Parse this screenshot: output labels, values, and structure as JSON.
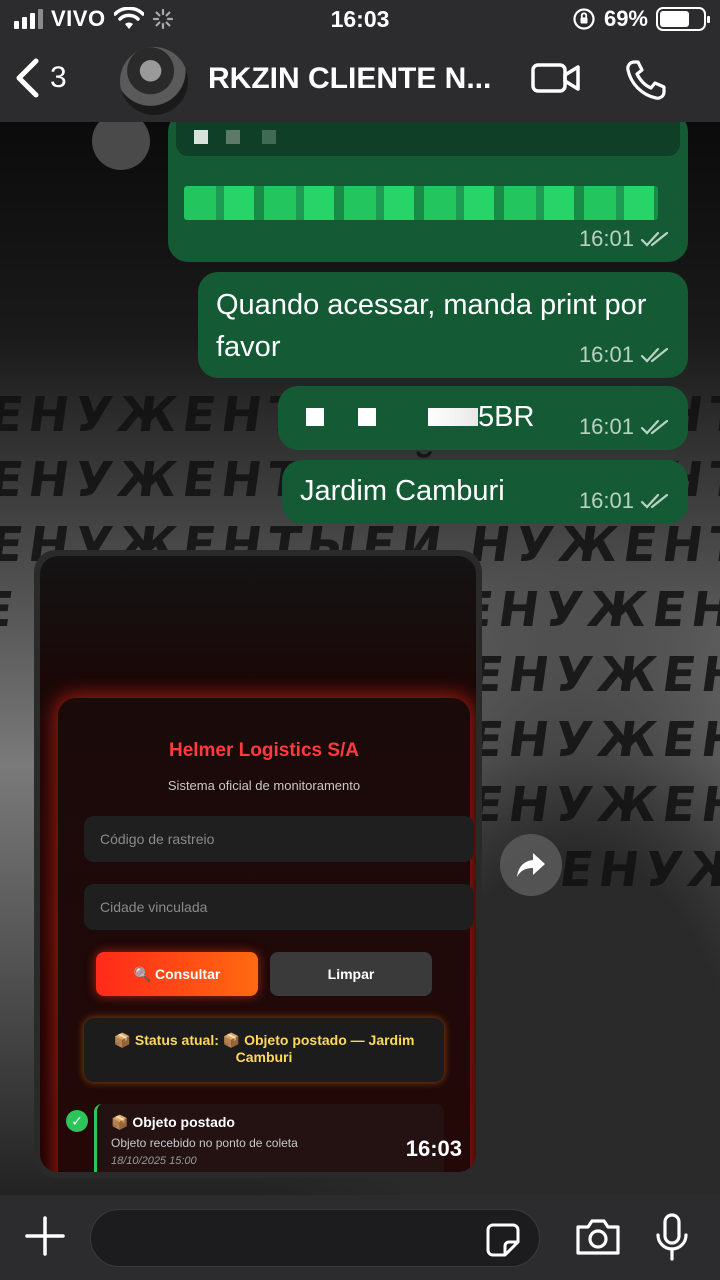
{
  "status_bar": {
    "carrier": "VIVO",
    "time": "16:03",
    "battery_percent": "69%",
    "battery_level": 0.69
  },
  "header": {
    "back_count": "3",
    "contact_name": "RKZIN CLIENTE N..."
  },
  "messages": [
    {
      "type": "redacted-link",
      "time": "16:01",
      "status": "read"
    },
    {
      "type": "text",
      "text": "Quando acessar, manda print por favor",
      "time": "16:01",
      "status": "read"
    },
    {
      "type": "redacted-text",
      "visible_suffix": "5BR",
      "time": "16:01",
      "status": "read"
    },
    {
      "type": "text",
      "text": "Jardim Camburi",
      "time": "16:01",
      "status": "read"
    }
  ],
  "screenshot": {
    "time": "16:03",
    "title": "Helmer Logistics S/A",
    "subtitle": "Sistema oficial de monitoramento",
    "tracking_placeholder": "Código de rastreio",
    "city_placeholder": "Cidade vinculada",
    "consult_button": "🔍 Consultar",
    "clear_button": "Limpar",
    "status_text": "📦 Status atual: 📦 Objeto postado — Jardim Camburi",
    "timeline_check": "✓",
    "timeline_title": "📦 Objeto postado",
    "timeline_desc": "Objeto recebido no ponto de coleta",
    "timeline_date": "18/10/2025 15:00"
  },
  "wall_text": "ЕНУЖЕНТЫЕЙ НУЖЕНТЫЕЙ НУЖЕНТЫЕЙ"
}
